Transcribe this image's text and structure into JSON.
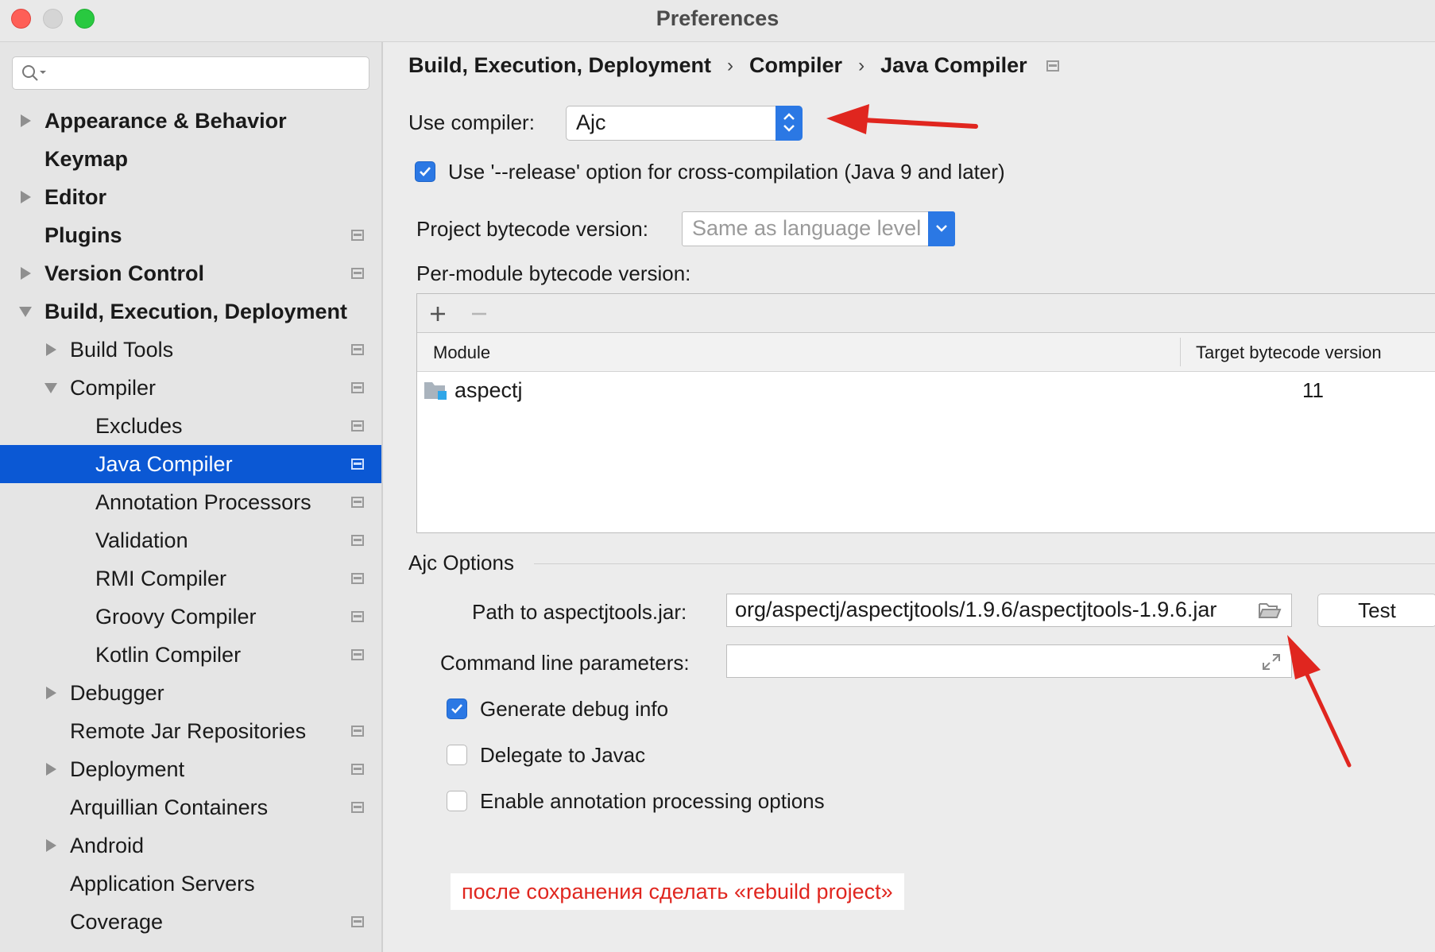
{
  "window": {
    "title": "Preferences"
  },
  "sidebar": {
    "items": [
      {
        "label": "Appearance & Behavior",
        "arrow": "right"
      },
      {
        "label": "Keymap"
      },
      {
        "label": "Editor",
        "arrow": "right"
      },
      {
        "label": "Plugins",
        "project_icon": true
      },
      {
        "label": "Version Control",
        "arrow": "right",
        "project_icon": true
      },
      {
        "label": "Build, Execution, Deployment",
        "arrow": "down"
      },
      {
        "label": "Build Tools",
        "arrow": "right",
        "project_icon": true
      },
      {
        "label": "Compiler",
        "arrow": "down",
        "project_icon": true
      },
      {
        "label": "Excludes",
        "project_icon": true
      },
      {
        "label": "Java Compiler",
        "project_icon": true,
        "selected": true
      },
      {
        "label": "Annotation Processors",
        "project_icon": true
      },
      {
        "label": "Validation",
        "project_icon": true
      },
      {
        "label": "RMI Compiler",
        "project_icon": true
      },
      {
        "label": "Groovy Compiler",
        "project_icon": true
      },
      {
        "label": "Kotlin Compiler",
        "project_icon": true
      },
      {
        "label": "Debugger",
        "arrow": "right"
      },
      {
        "label": "Remote Jar Repositories",
        "project_icon": true
      },
      {
        "label": "Deployment",
        "arrow": "right",
        "project_icon": true
      },
      {
        "label": "Arquillian Containers",
        "project_icon": true
      },
      {
        "label": "Android",
        "arrow": "right"
      },
      {
        "label": "Application Servers"
      },
      {
        "label": "Coverage",
        "project_icon": true
      }
    ]
  },
  "breadcrumb": [
    "Build, Execution, Deployment",
    "Compiler",
    "Java Compiler"
  ],
  "compiler": {
    "use_compiler_label": "Use compiler:",
    "use_compiler_value": "Ajc",
    "release_option_label": "Use '--release' option for cross-compilation (Java 9 and later)",
    "release_option_checked": true,
    "project_bytecode_label": "Project bytecode version:",
    "project_bytecode_placeholder": "Same as language level",
    "per_module_label": "Per-module bytecode version:",
    "table": {
      "columns": [
        "Module",
        "Target bytecode version"
      ],
      "rows": [
        {
          "module": "aspectj",
          "target": "11"
        }
      ]
    }
  },
  "ajc": {
    "section_title": "Ajc Options",
    "path_label": "Path to aspectjtools.jar:",
    "path_value": "org/aspectj/aspectjtools/1.9.6/aspectjtools-1.9.6.jar",
    "test_button": "Test",
    "cmd_label": "Command line parameters:",
    "cmd_value": "",
    "options": [
      {
        "label": "Generate debug info",
        "checked": true
      },
      {
        "label": "Delegate to Javac",
        "checked": false
      },
      {
        "label": "Enable annotation processing options",
        "checked": false
      }
    ]
  },
  "annotation_note": "после сохранения сделать «rebuild project»",
  "colors": {
    "accent": "#2b78e4",
    "selection": "#0b58d4",
    "annotation": "#e0261f"
  }
}
